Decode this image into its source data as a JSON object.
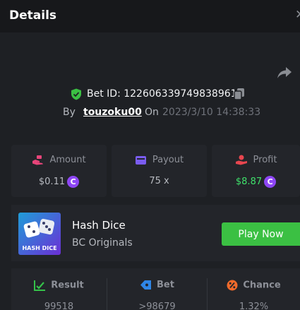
{
  "header": {
    "title": "Details"
  },
  "bet": {
    "id_text": "Bet ID: 122606339749838961",
    "by_label": "By",
    "username": "touzoku00",
    "on_label": "On",
    "date": "2023/3/10 14:38:33"
  },
  "stats_cards": [
    {
      "label": "Amount",
      "value": "$0.11",
      "icon": "money-hand-icon",
      "has_coin": true
    },
    {
      "label": "Payout",
      "value": "75 x",
      "icon": "wallet-icon",
      "has_coin": false
    },
    {
      "label": "Profit",
      "value": "$8.87",
      "icon": "profit-hand-icon",
      "has_coin": true
    }
  ],
  "coin_symbol": "C",
  "game": {
    "name": "Hash Dice",
    "provider": "BC Originals",
    "thumb_text": "HASH DICE",
    "play_label": "Play Now"
  },
  "result_stats": [
    {
      "label": "Result",
      "value": "99518",
      "icon": "chart-check-icon"
    },
    {
      "label": "Bet",
      "value": ">98679",
      "icon": "tag-icon"
    },
    {
      "label": "Chance",
      "value": "1.32%",
      "icon": "percent-icon"
    }
  ],
  "colors": {
    "background": "#1e2024",
    "card": "#23252a",
    "header": "#17181b",
    "accent_green": "#3bc043",
    "profit_green": "#3fe06b",
    "coin_purple": "#8e46f5",
    "payout_purple": "#7a5cf0",
    "amount_pink": "#e9457a",
    "profit_red": "#e8464f",
    "result_green": "#35c24a",
    "bet_blue": "#2f86e6",
    "chance_orange": "#f06a2b"
  }
}
